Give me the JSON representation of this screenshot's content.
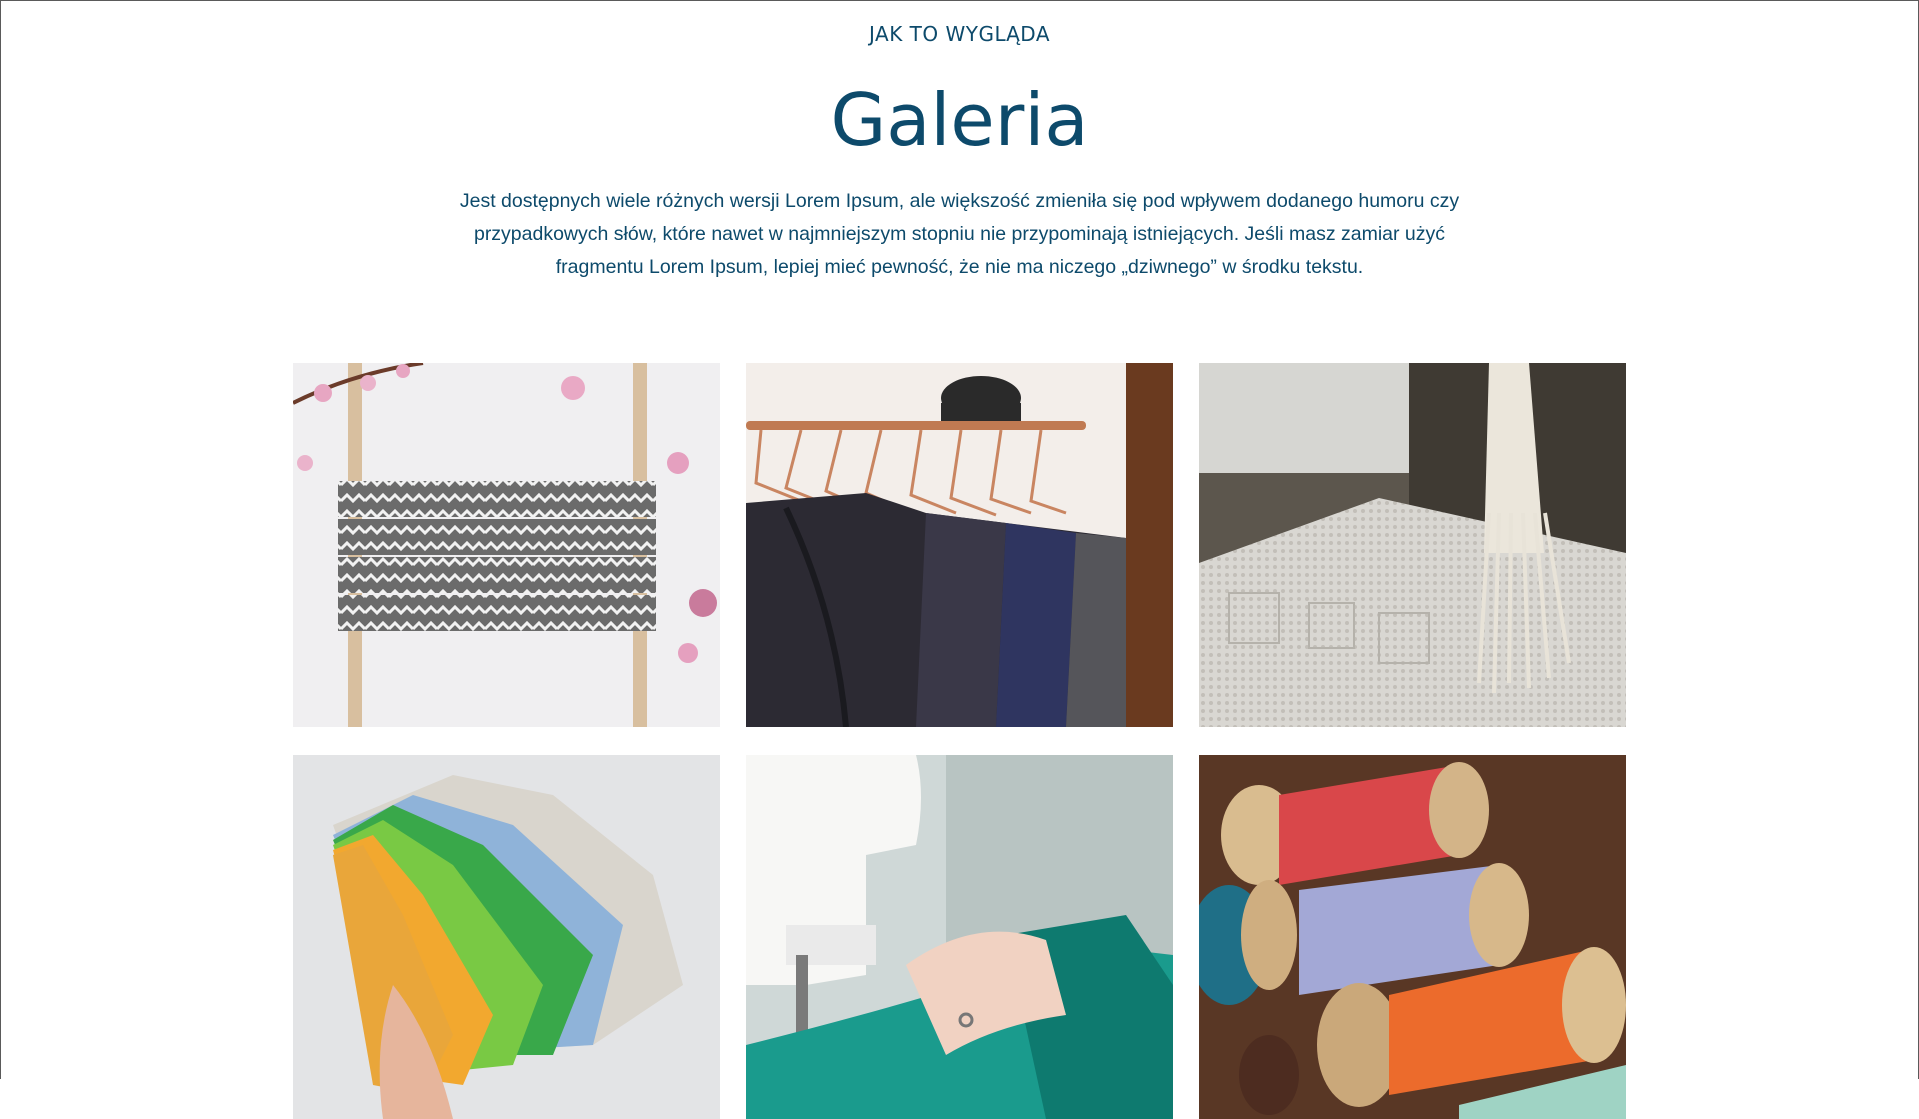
{
  "header": {
    "eyebrow": "JAK TO WYGLĄDA",
    "title": "Galeria",
    "lead": "Jest dostępnych wiele różnych wersji Lorem Ipsum, ale większość zmieniła się pod wpływem dodanego humoru czy przypadkowych słów, które nawet w najmniejszym stopniu nie przypominają istniejących. Jeśli masz zamiar użyć fragmentu Lorem Ipsum, lepiej mieć pewność, że nie ma niczego „dziwnego” w środku tekstu."
  },
  "gallery": {
    "items": [
      {
        "image": "chevron-fabric-face-mask-with-cherry-blossoms"
      },
      {
        "image": "clothes-rack-with-copper-hangers"
      },
      {
        "image": "white-crochet-lace-with-fringe"
      },
      {
        "image": "hand-holding-stack-of-colorful-face-masks"
      },
      {
        "image": "hands-sewing-teal-fabric-on-machine"
      },
      {
        "image": "wooden-spools-of-colored-thread"
      }
    ]
  },
  "colors": {
    "heading": "#0d4a6b",
    "background": "#ffffff"
  }
}
